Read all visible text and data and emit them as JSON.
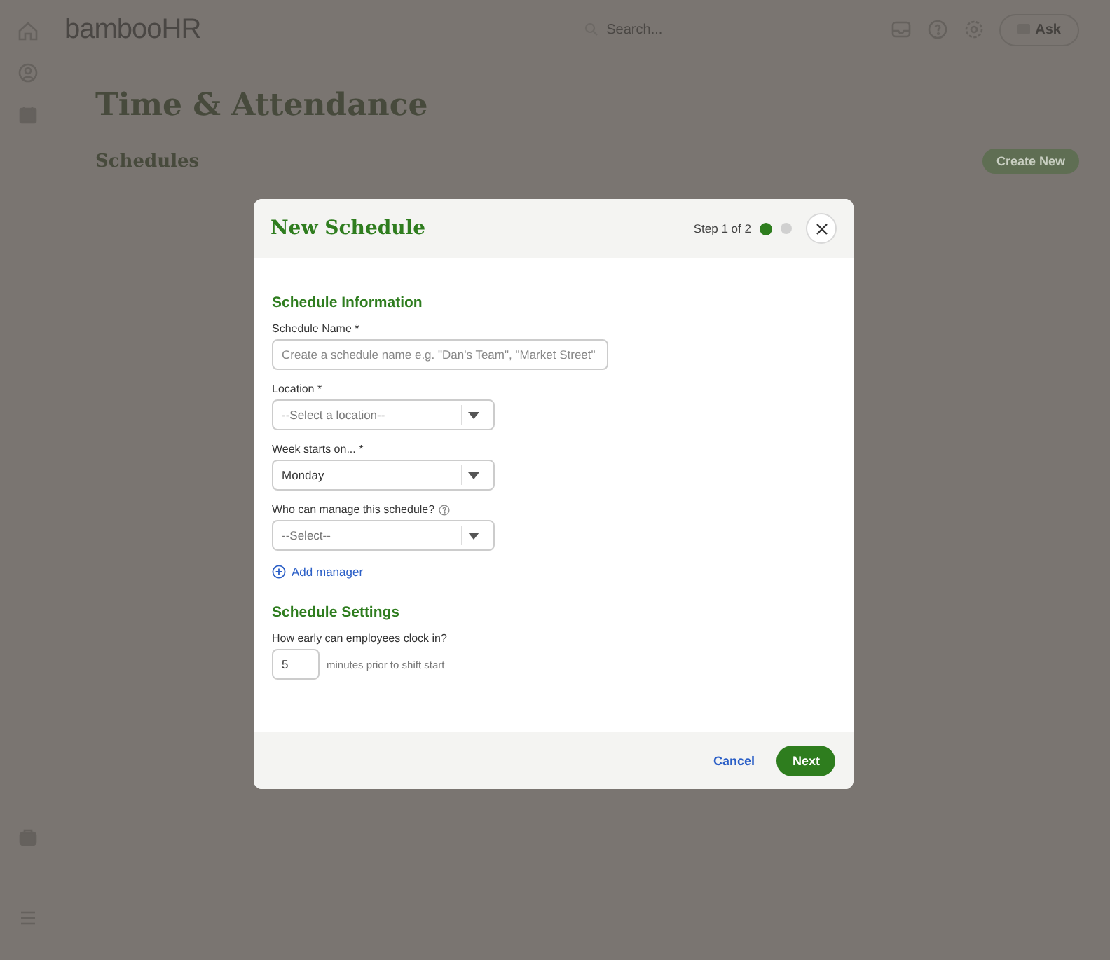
{
  "app": {
    "logo": "bambooHR",
    "search": {
      "placeholder": "Search..."
    },
    "ask_button": "Ask",
    "page_title": "Time & Attendance",
    "section_title": "Schedules",
    "create_button": "Create New"
  },
  "dialog": {
    "title": "New Schedule",
    "step_text": "Step 1 of 2",
    "steps": [
      {
        "selected": true
      },
      {
        "selected": false
      }
    ],
    "sections": [
      {
        "title": "Schedule Information",
        "fields": [
          {
            "kind": "text",
            "label": "Schedule Name *",
            "placeholder": "Create a schedule name e.g. \"Dan's Team\", \"Market Street\""
          },
          {
            "kind": "select",
            "label": "Location *",
            "placeholder": "--Select a location--"
          },
          {
            "kind": "select",
            "label": "Week starts on... *",
            "value": "Monday"
          },
          {
            "kind": "select",
            "label": "Who can manage this schedule?",
            "help": true,
            "placeholder": "--Select--"
          },
          {
            "kind": "link",
            "label": "Add manager"
          }
        ]
      },
      {
        "title": "Schedule Settings",
        "fields": [
          {
            "kind": "number",
            "label": "How early can employees clock in?",
            "value": "5",
            "suffix": "minutes prior to shift start"
          }
        ]
      }
    ],
    "cancel": "Cancel",
    "next": "Next"
  }
}
